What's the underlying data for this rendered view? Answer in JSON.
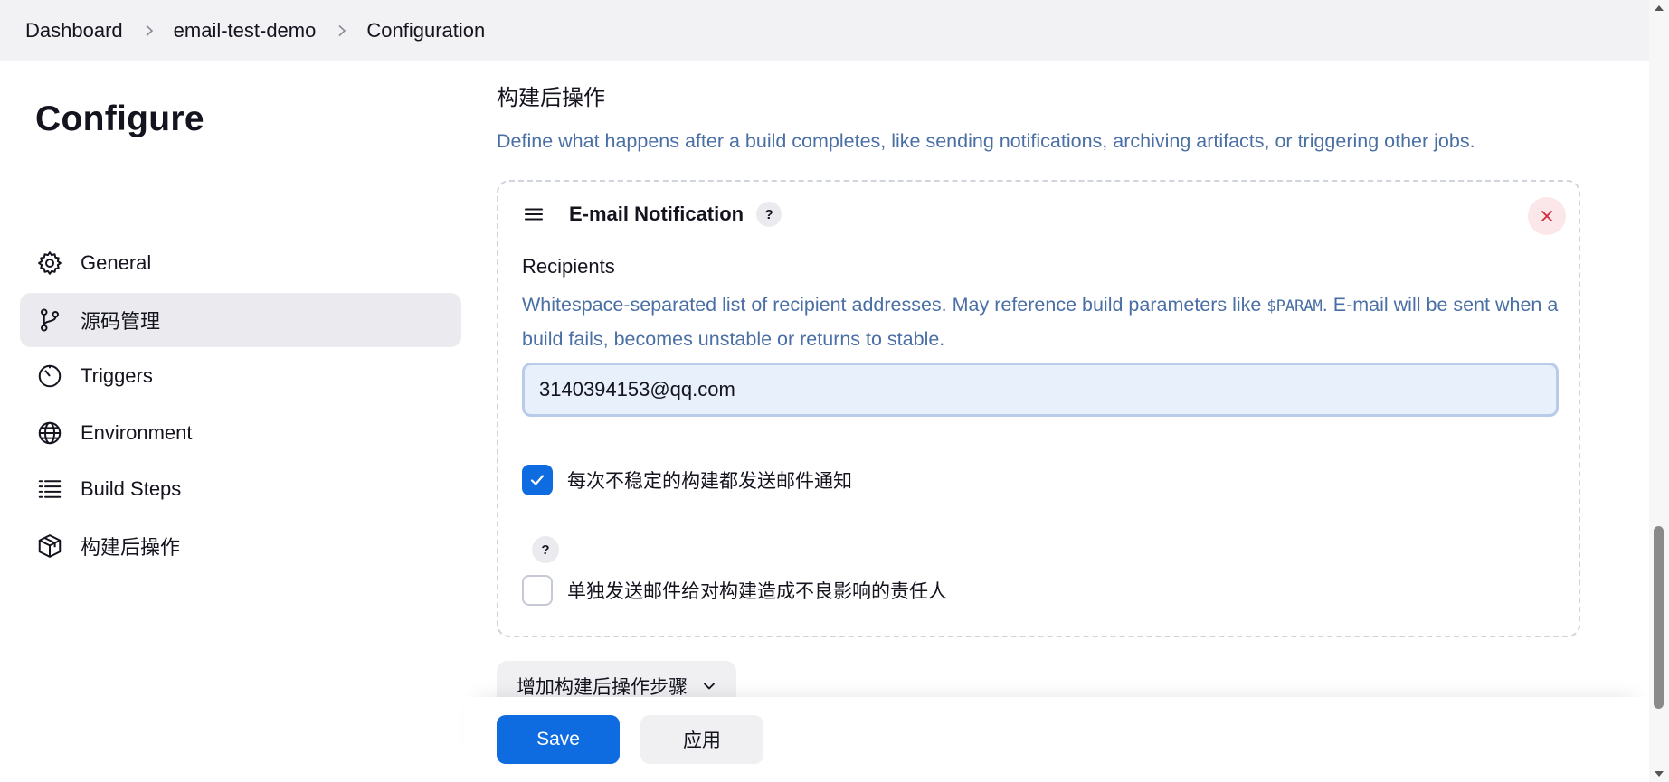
{
  "breadcrumb": {
    "items": [
      "Dashboard",
      "email-test-demo",
      "Configuration"
    ]
  },
  "sidebar": {
    "title": "Configure",
    "items": [
      {
        "label": "General",
        "icon": "gear-icon"
      },
      {
        "label": "源码管理",
        "icon": "branch-icon",
        "active": true
      },
      {
        "label": "Triggers",
        "icon": "timer-icon"
      },
      {
        "label": "Environment",
        "icon": "globe-icon"
      },
      {
        "label": "Build Steps",
        "icon": "list-icon"
      },
      {
        "label": "构建后操作",
        "icon": "package-icon"
      }
    ]
  },
  "main": {
    "section_title": "构建后操作",
    "section_desc": "Define what happens after a build completes, like sending notifications, archiving artifacts, or triggering other jobs.",
    "card": {
      "title": "E-mail Notification",
      "help": "?",
      "recipients_label": "Recipients",
      "recipients_desc_pre": "Whitespace-separated list of recipient addresses. May reference build parameters like ",
      "recipients_desc_code": "$PARAM",
      "recipients_desc_post": ". E-mail will be sent when a build fails, becomes unstable or returns to stable.",
      "recipients_value": "3140394153@qq.com",
      "check_unstable_label": "每次不稳定的构建都发送邮件通知",
      "check_unstable_checked": true,
      "check_individual_label": "单独发送邮件给对构建造成不良影响的责任人",
      "check_individual_checked": false,
      "help_small": "?"
    },
    "add_step_label": "增加构建后操作步骤"
  },
  "footer": {
    "save_label": "Save",
    "apply_label": "应用"
  },
  "colors": {
    "accent": "#0f6be0",
    "desc_text": "#4a6fa5",
    "close_bg": "#fbe6e9",
    "close_icon": "#d02a3b",
    "breadcrumb_bg": "#f2f2f5"
  }
}
